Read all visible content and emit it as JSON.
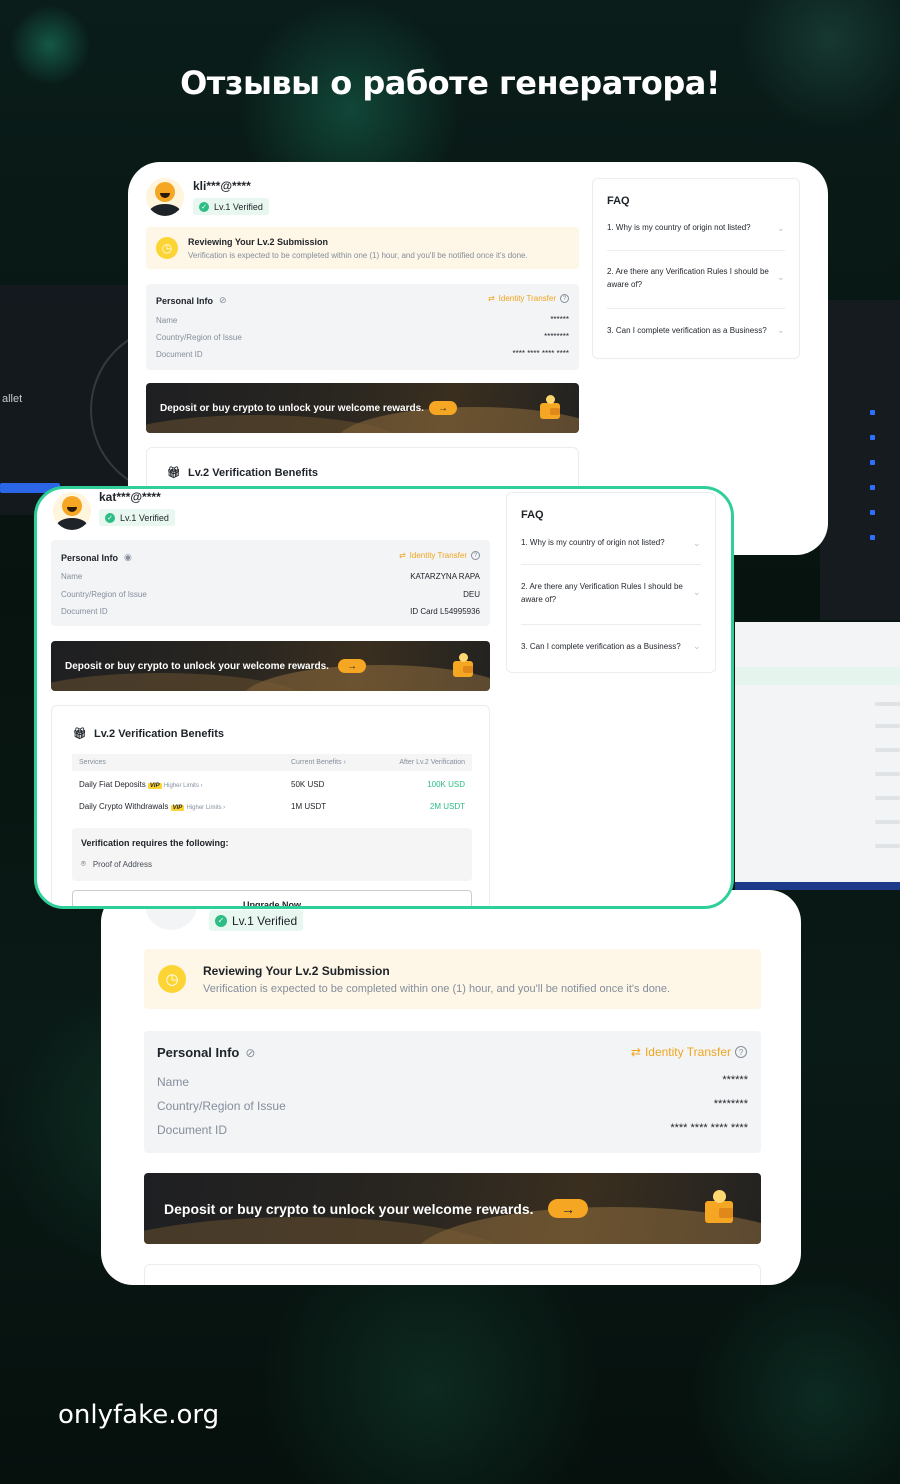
{
  "headline": "Отзывы о работе генератора!",
  "footer": "onlyfake.org",
  "background": {
    "left_panel_text": "allet"
  },
  "card1": {
    "username": "kli***@****",
    "badge": "Lv.1 Verified",
    "notice_title": "Reviewing Your Lv.2 Submission",
    "notice_sub": "Verification is expected to be completed within one (1) hour, and you'll be notified once it's done.",
    "info_title": "Personal Info",
    "identity_transfer": "Identity Transfer",
    "rows": [
      {
        "label": "Name",
        "value": "******"
      },
      {
        "label": "Country/Region of Issue",
        "value": "********"
      },
      {
        "label": "Document ID",
        "value": "**** **** **** ****"
      }
    ],
    "promo": "Deposit or buy crypto to unlock your welcome rewards.",
    "benefits_title": "Lv.2 Verification Benefits",
    "faq_title": "FAQ",
    "faq": [
      "1. Why is my country of origin not listed?",
      "2. Are there any Verification Rules I should be aware of?",
      "3. Can I complete verification as a Business?"
    ]
  },
  "card2": {
    "username": "kat***@****",
    "badge": "Lv.1 Verified",
    "info_title": "Personal Info",
    "identity_transfer": "Identity Transfer",
    "rows": [
      {
        "label": "Name",
        "value": "KATARZYNA RAPA"
      },
      {
        "label": "Country/Region of Issue",
        "value": "DEU"
      },
      {
        "label": "Document ID",
        "value": "ID Card L54995936"
      }
    ],
    "promo": "Deposit or buy crypto to unlock your welcome rewards.",
    "benefits_title": "Lv.2 Verification Benefits",
    "table_head": {
      "services": "Services",
      "current": "Current Benefits",
      "after": "After Lv.2 Verification"
    },
    "table_rows": [
      {
        "service": "Daily Fiat Deposits",
        "vip": "VIP",
        "limits": "Higher Limits",
        "current": "50K USD",
        "after": "100K USD"
      },
      {
        "service": "Daily Crypto Withdrawals",
        "vip": "VIP",
        "limits": "Higher Limits",
        "current": "1M USDT",
        "after": "2M USDT"
      }
    ],
    "req_title": "Verification requires the following:",
    "req_item": "Proof of Address",
    "upgrade": "Upgrade Now",
    "faq_title": "FAQ",
    "faq": [
      "1. Why is my country of origin not listed?",
      "2. Are there any Verification Rules I should be aware of?",
      "3. Can I complete verification as a Business?"
    ]
  },
  "card3": {
    "badge": "Lv.1 Verified",
    "notice_title": "Reviewing Your Lv.2 Submission",
    "notice_sub": "Verification is expected to be completed within one (1) hour, and you'll be notified once it's done.",
    "info_title": "Personal Info",
    "identity_transfer": "Identity Transfer",
    "rows": [
      {
        "label": "Name",
        "value": "******"
      },
      {
        "label": "Country/Region of Issue",
        "value": "********"
      },
      {
        "label": "Document ID",
        "value": "**** **** **** ****"
      }
    ],
    "promo": "Deposit or buy crypto to unlock your welcome rewards."
  }
}
